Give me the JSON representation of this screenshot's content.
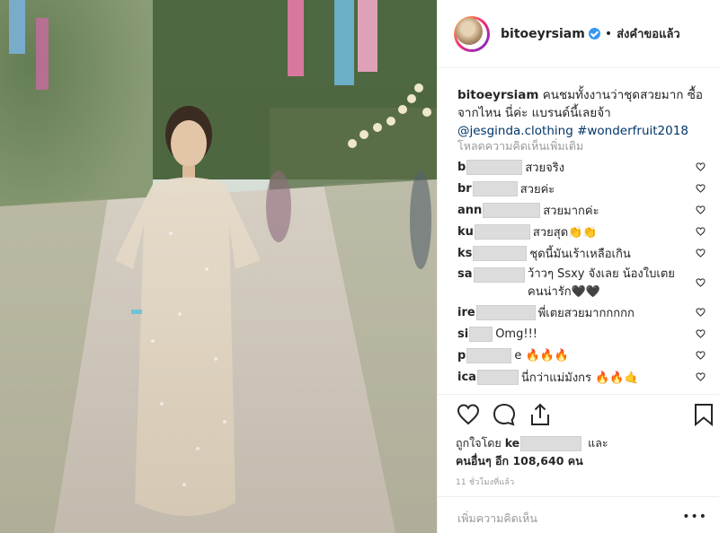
{
  "post": {
    "username": "bitoeyrsiam",
    "header_separator": "•",
    "follow_status": "ส่งคำขอแล้ว",
    "caption_user": "bitoeyrsiam",
    "caption_text": " คนชมทั้งงานว่าชุดสวยมาก ซื้อจากไหน นี่ค่ะ แบรนด์นี้เลยจ้า ",
    "caption_mention": "@jesginda.clothing",
    "caption_hashtag": "#wonderfruit2018",
    "load_more": "โหลดความคิดเห็นเพิ่มเติม"
  },
  "comments": [
    {
      "user": "b",
      "blur": "blur",
      "text": " สวยจริง"
    },
    {
      "user": "br",
      "blur": "blur",
      "text": " สวยค่ะ"
    },
    {
      "user": "ann",
      "blur": "blur",
      "text": " สวยมากค่ะ"
    },
    {
      "user": "ku",
      "blur": "blur",
      "text": " สวยสุด👏👏"
    },
    {
      "user": "ks",
      "blur": "blur",
      "text": " ชุดนี้มันเร้าเหลือเกิน"
    },
    {
      "user": "sa",
      "blur": "blur",
      "text": " ว้าวๆ Ssxy จังเลย น้องใบเตยคนน่ารัก🖤🖤"
    },
    {
      "user": "ire",
      "blur": "blur",
      "text": " พี่เตยสวยมากกกกก"
    },
    {
      "user": "si",
      "blur": "blur",
      "text": " Omg!!!"
    },
    {
      "user": "p",
      "blur": "blur",
      "text": "e 🔥🔥🔥"
    },
    {
      "user": "ica",
      "blur": "blur",
      "text": " นี่กว่าแม่มังกร 🔥🔥🤙"
    }
  ],
  "actions": {
    "liked_by_prefix": "ถูกใจโดย ",
    "liked_by_user": "ke",
    "liked_by_suffix": " และ",
    "others_prefix": "คนอื่นๆ อีก ",
    "others_count": "108,640",
    "others_suffix": " คน",
    "time_ago": "11 ชั่วโมงที่แล้ว"
  },
  "add_comment": {
    "placeholder": "เพิ่มความคิดเห็น",
    "more": "•••"
  },
  "colors": {
    "link": "#003569",
    "muted": "#999999",
    "verified": "#3897f0"
  }
}
